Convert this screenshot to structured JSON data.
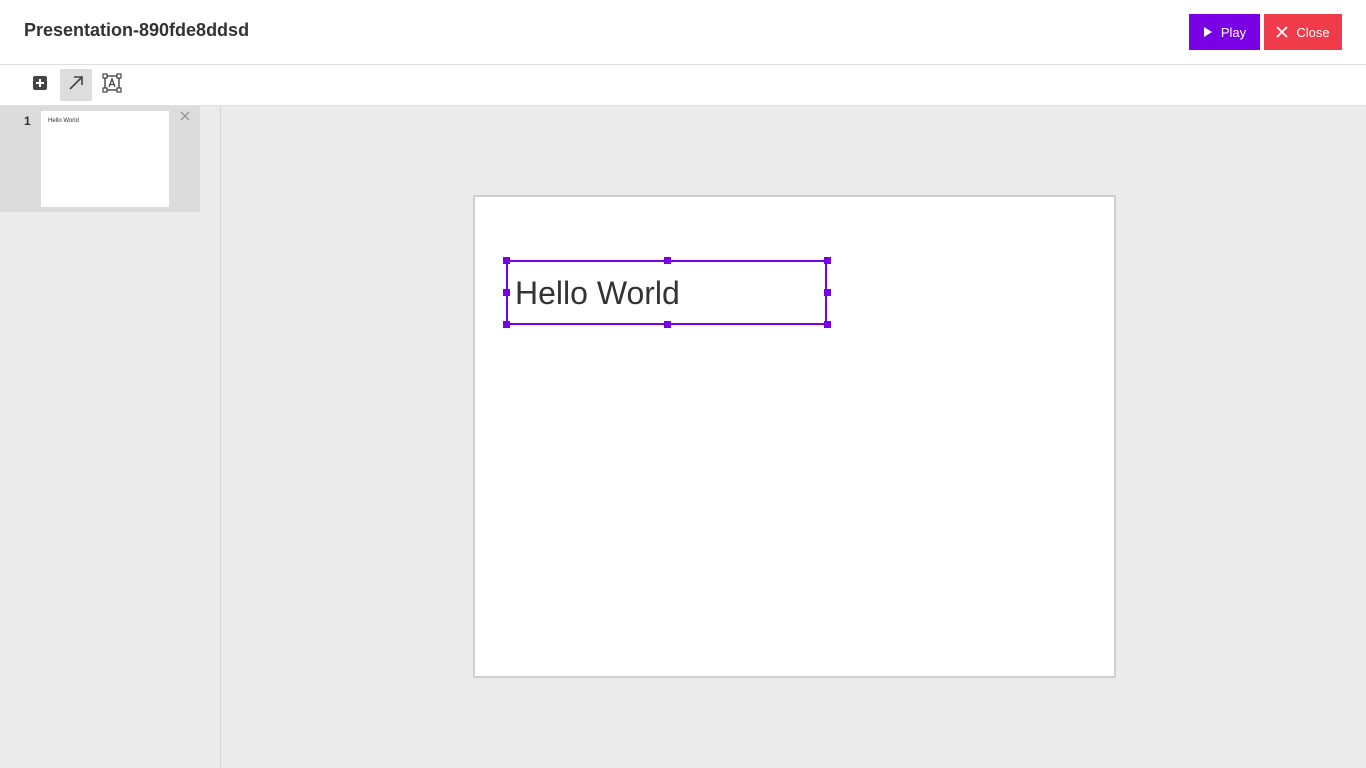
{
  "app": {
    "title": "Presentation-890fde8ddsd"
  },
  "header": {
    "play_label": "Play",
    "close_label": "Close",
    "play_color": "#7a00e6",
    "close_color": "#f03b4a"
  },
  "toolbar": {
    "tools": [
      {
        "name": "add-slide",
        "icon": "plus-square-icon",
        "active": false
      },
      {
        "name": "arrow",
        "icon": "arrow-up-right-icon",
        "active": true
      },
      {
        "name": "text-box",
        "icon": "text-box-icon",
        "active": false
      }
    ]
  },
  "sidebar": {
    "slides": [
      {
        "number": "1",
        "thumb_text": "Hello World",
        "selected": true
      }
    ]
  },
  "editor": {
    "textbox_text": "Hello World",
    "selection_color": "#7a00e6"
  }
}
